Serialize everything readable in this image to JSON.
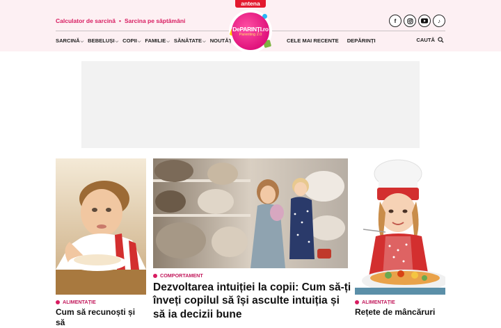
{
  "brand": {
    "antena": "antena",
    "logo_main": "DePARINȚI.ro",
    "logo_sub": "Parenting 2.0"
  },
  "top_links": [
    "Calculator de sarcină",
    "Sarcina pe săptămâni"
  ],
  "social_icons": [
    "facebook-icon",
    "instagram-icon",
    "youtube-icon",
    "tiktok-icon"
  ],
  "nav": [
    {
      "label": "SARCINĂ",
      "has_dropdown": true
    },
    {
      "label": "BEBELUȘI",
      "has_dropdown": true
    },
    {
      "label": "COPII",
      "has_dropdown": true
    },
    {
      "label": "FAMILIE",
      "has_dropdown": true
    },
    {
      "label": "SĂNĂTATE",
      "has_dropdown": true
    },
    {
      "label": "NOUTĂȚI",
      "has_dropdown": false
    }
  ],
  "nav_secondary": [
    "CELE MAI RECENTE",
    "DEPĂRINȚI"
  ],
  "search": {
    "label": "CAUTĂ"
  },
  "articles": [
    {
      "category": "ALIMENTAȚIE",
      "title": "Cum să recunoști și să"
    },
    {
      "category": "COMPORTAMENT",
      "title": "Dezvoltarea intuiției la copii: Cum să-ți înveți copilul să își asculte intuiția și să ia decizii bune"
    },
    {
      "category": "ALIMENTAȚIE",
      "title": "Rețete de mâncăruri"
    }
  ],
  "colors": {
    "accent": "#d81b60",
    "header_bg": "#fdf0f3",
    "ad_bg": "#f2f2f2"
  }
}
